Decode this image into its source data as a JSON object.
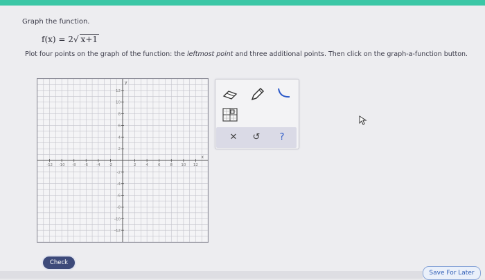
{
  "question": {
    "instruction": "Graph the function.",
    "formula_lhs": "f(x) = 2",
    "formula_radicand": "x+1",
    "plot_prefix": "Plot four points on the graph of the function: the ",
    "plot_emphasis": "leftmost point",
    "plot_suffix": " and three additional points. Then click on the graph-a-function button."
  },
  "graph": {
    "x_axis_label": "x",
    "y_axis_label": "y",
    "x_ticks": [
      "-12",
      "-10",
      "-8",
      "-6",
      "-4",
      "-2",
      "2",
      "4",
      "6",
      "8",
      "10",
      "12"
    ],
    "y_ticks": [
      "12",
      "10",
      "8",
      "6",
      "4",
      "2",
      "-2",
      "-4",
      "-6",
      "-8",
      "-10",
      "-12"
    ],
    "x_range": [
      -14,
      14
    ],
    "y_range": [
      -14,
      14
    ],
    "grid": true
  },
  "toolbox": {
    "tools": [
      "eraser-icon",
      "pencil-icon",
      "curve-icon",
      "graph-a-function-icon"
    ],
    "close_label": "✕",
    "undo_label": "↺",
    "help_label": "?"
  },
  "buttons": {
    "check": "Check",
    "save_for_later": "Save For Later"
  },
  "colors": {
    "top_bar": "#3cc7a6",
    "check_button": "#3d4a7a",
    "save_button_text": "#2f5db5"
  }
}
